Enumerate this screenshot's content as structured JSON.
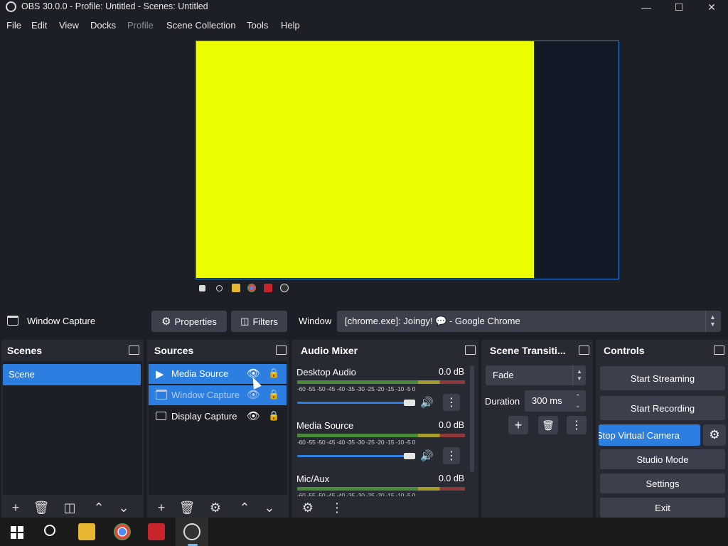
{
  "window": {
    "title": "OBS 30.0.0 - Profile: Untitled - Scenes: Untitled"
  },
  "menu": [
    "File",
    "Edit",
    "View",
    "Docks",
    "Profile",
    "Scene Collection",
    "Tools",
    "Help"
  ],
  "source_toolbar": {
    "selected_source": "Window Capture",
    "properties_label": "Properties",
    "filters_label": "Filters",
    "window_label": "Window",
    "window_value": "[chrome.exe]: Joingy! 💬 - Google Chrome"
  },
  "scenes": {
    "title": "Scenes",
    "items": [
      "Scene"
    ]
  },
  "sources": {
    "title": "Sources",
    "items": [
      "Media Source",
      "Window Capture",
      "Display Capture"
    ]
  },
  "audio_mixer": {
    "title": "Audio Mixer",
    "ticks": "-60 -55 -50 -45 -40 -35 -30 -25 -20 -15 -10 -5  0",
    "channels": [
      {
        "name": "Desktop Audio",
        "level": "0.0 dB"
      },
      {
        "name": "Media Source",
        "level": "0.0 dB"
      },
      {
        "name": "Mic/Aux",
        "level": "0.0 dB"
      }
    ]
  },
  "transitions": {
    "title": "Scene Transiti...",
    "selected": "Fade",
    "duration_label": "Duration",
    "duration_value": "300 ms"
  },
  "controls": {
    "title": "Controls",
    "start_streaming": "Start Streaming",
    "start_recording": "Start Recording",
    "virtual_camera": "Stop Virtual Camera",
    "studio_mode": "Studio Mode",
    "settings": "Settings",
    "exit": "Exit"
  },
  "colors": {
    "accent": "#2c7fe0",
    "preview_fill": "#ebff00",
    "panel": "#272a33",
    "bg": "#1d1f26"
  }
}
